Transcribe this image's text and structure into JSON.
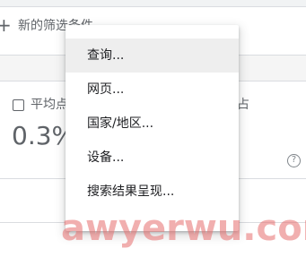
{
  "filter_bar": {
    "add_icon": "plus-icon",
    "new_filter_label": "新的筛选条件"
  },
  "metric_card": {
    "checkbox_label": "平均点",
    "right_label": "占",
    "value": "0.3%",
    "help_icon": "help-circle-icon"
  },
  "menu": {
    "items": [
      {
        "label": "查询..."
      },
      {
        "label": "网页..."
      },
      {
        "label": "国家/地区..."
      },
      {
        "label": "设备..."
      },
      {
        "label": "搜索结果呈现..."
      }
    ]
  },
  "watermark": {
    "text": "awyerwu.com"
  },
  "colors": {
    "menu_highlight": "#eeeeee",
    "text_secondary": "#5f6368",
    "divider": "#dadce0",
    "watermark": "#e66e6e"
  }
}
